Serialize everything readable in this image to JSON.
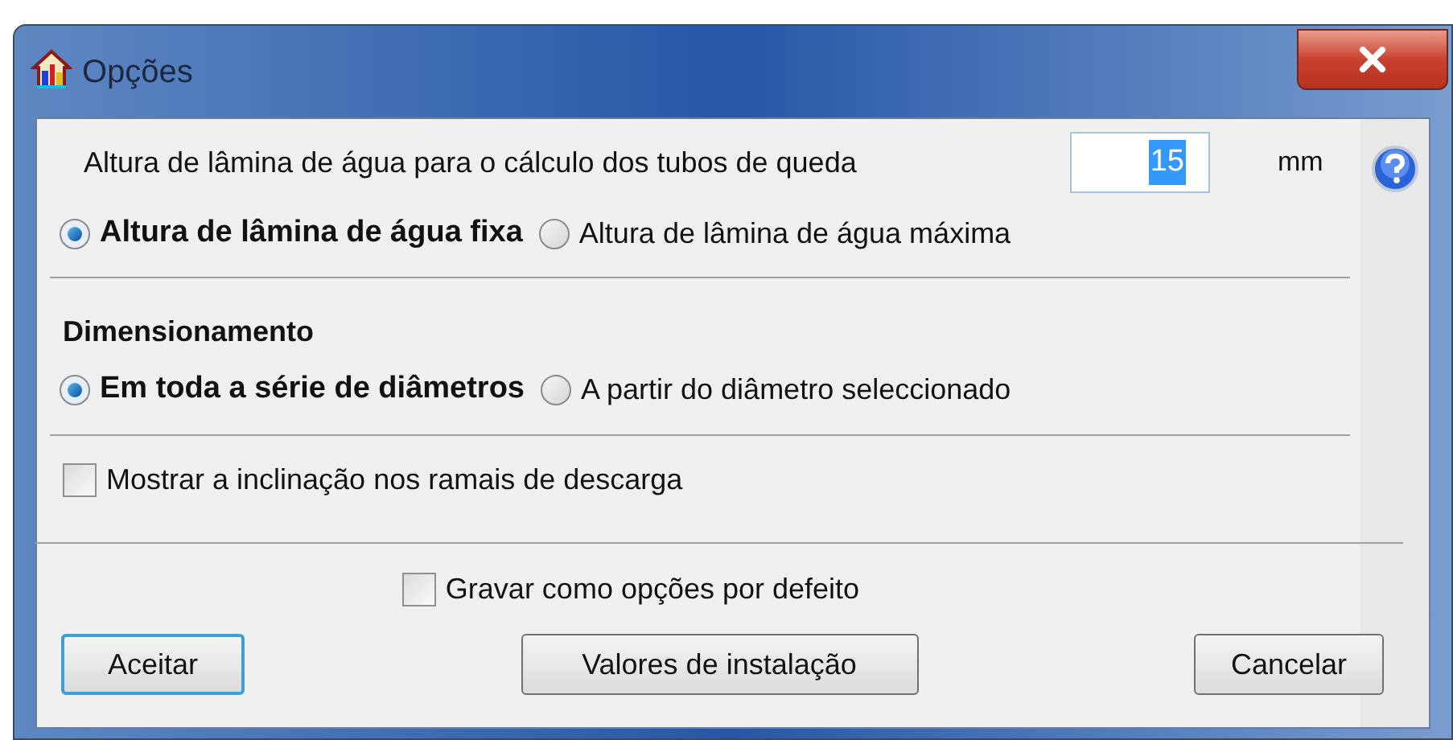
{
  "window": {
    "title": "Opções"
  },
  "water_height": {
    "label": "Altura de lâmina de água para o cálculo dos tubos de queda",
    "value": "15",
    "value_selected": true,
    "unit": "mm"
  },
  "water_mode": [
    {
      "label": "Altura de lâmina de água fixa",
      "selected": true
    },
    {
      "label": "Altura de lâmina de água máxima",
      "selected": false
    }
  ],
  "dimensioning": {
    "heading": "Dimensionamento",
    "options": [
      {
        "label": "Em toda a série de diâmetros",
        "selected": true
      },
      {
        "label": "A partir do diâmetro seleccionado",
        "selected": false
      }
    ]
  },
  "show_slope": {
    "label": "Mostrar a inclinação nos ramais de descarga",
    "checked": false
  },
  "save_default": {
    "label": "Gravar como opções por defeito",
    "checked": false
  },
  "buttons": [
    {
      "label": "Aceitar",
      "default": true
    },
    {
      "label": "Valores de instalação",
      "default": false
    },
    {
      "label": "Cancelar",
      "default": false
    }
  ]
}
